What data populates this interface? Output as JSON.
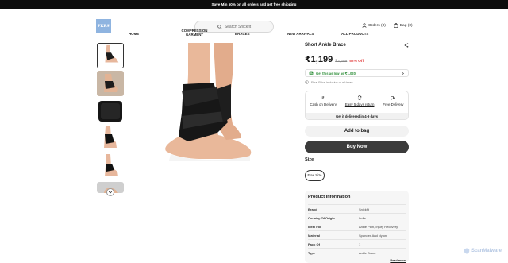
{
  "announcement": "Save Min 50% on all orders and get free shipping",
  "logo": "FKRS",
  "search": {
    "placeholder": "Search Snickfit"
  },
  "header": {
    "orders": "Orders (0)",
    "bag": "Bag (0)"
  },
  "nav": [
    "HOME",
    "COMPRESSION GARMENT",
    "BRACES",
    "NEW ARRIVALS",
    "ALL PRODUCTS"
  ],
  "product": {
    "title": "Short Ankle Brace",
    "price": "₹1,199",
    "mrp": "₹2,499",
    "discount": "52% Off",
    "offer": "Get this as low as ₹1,020",
    "tax_note": "Final Price inclusive of all taxes",
    "features": [
      "Cash on Delivery",
      "Easy 5 days return",
      "Free Delivery"
    ],
    "delivery": "Get it delivered in 4-9 days",
    "add_to_bag": "Add to bag",
    "buy_now": "Buy Now"
  },
  "size": {
    "heading": "Size",
    "options": [
      "Free Size"
    ]
  },
  "info": {
    "heading": "Product Information",
    "rows": [
      {
        "k": "Brand",
        "v": "Snickfit"
      },
      {
        "k": "Country Of Origin",
        "v": "India"
      },
      {
        "k": "Ideal For",
        "v": "Ankle Pain, Injury Recovery"
      },
      {
        "k": "Material",
        "v": "Spandex And Nylon"
      },
      {
        "k": "Pack Of",
        "v": "1"
      },
      {
        "k": "Type",
        "v": "Ankle Brace"
      }
    ],
    "read_more": "Read more"
  },
  "watermark": "ScanMalware",
  "colors": {
    "accent_red": "#e23c3c",
    "offer_green": "#2f8f3a",
    "buy_button": "#3b3b3b",
    "logo_bg": "#8fb4e0"
  }
}
